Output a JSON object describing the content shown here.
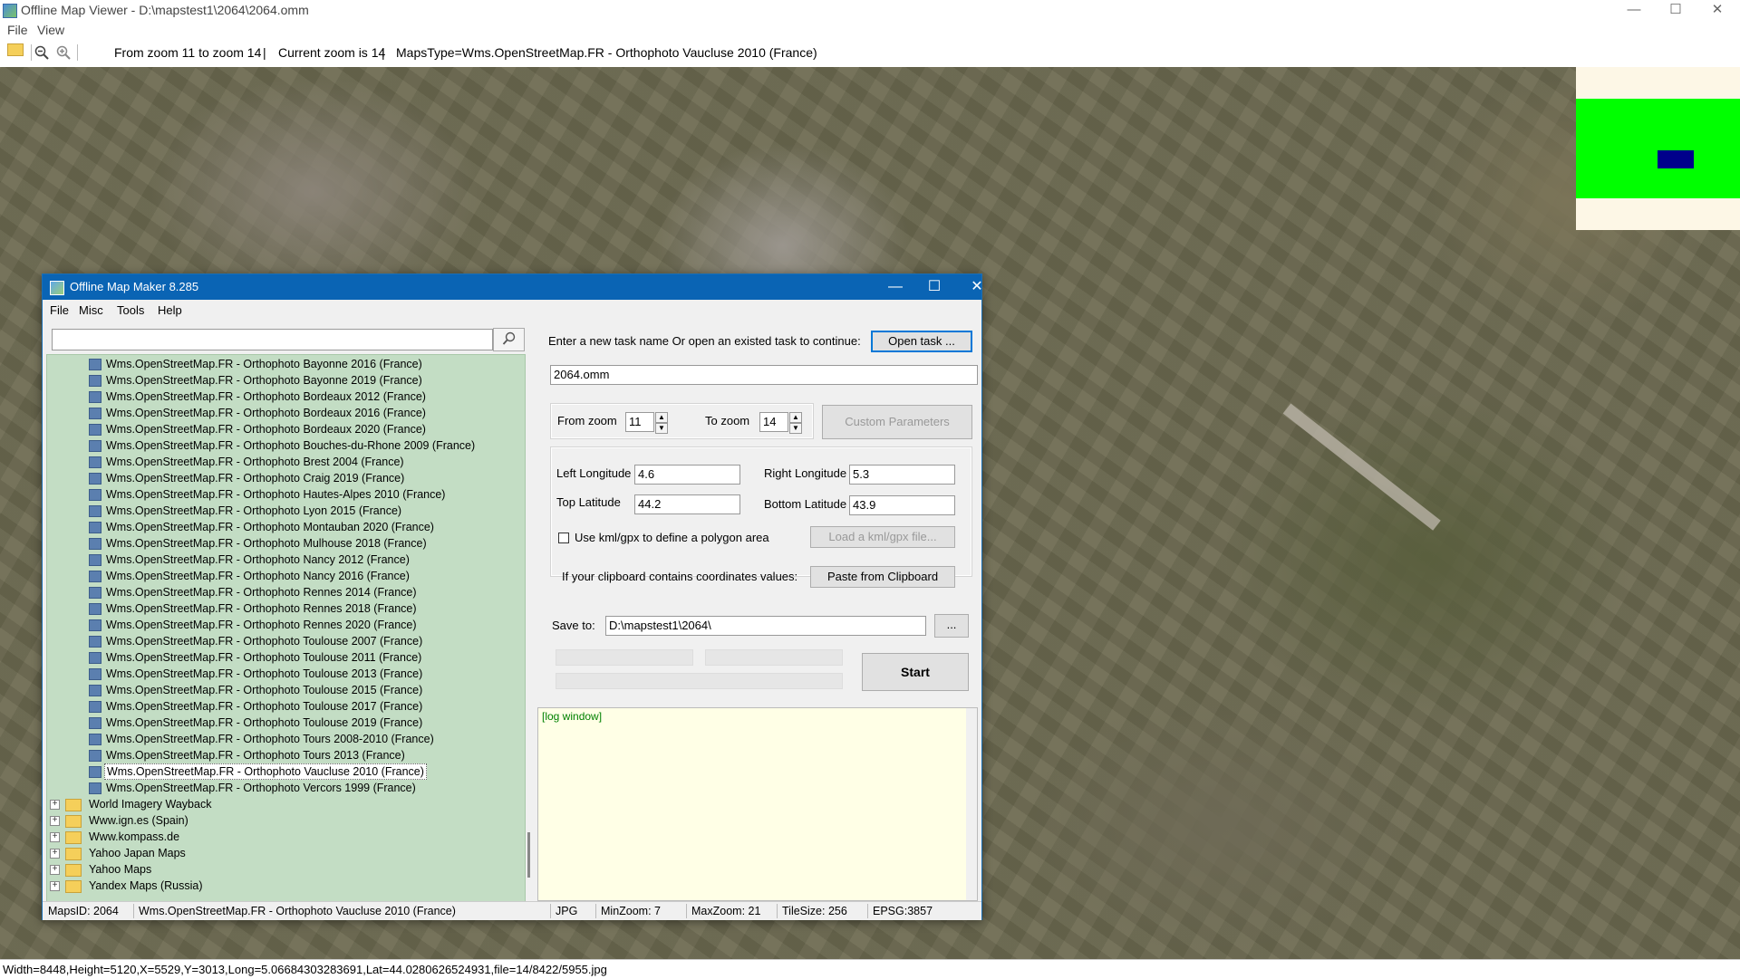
{
  "outer_window": {
    "title": "Offline Map Viewer - D:\\mapstest1\\2064\\2064.omm",
    "menu": [
      "File",
      "View"
    ],
    "toolbar": {
      "zoom_range_text": "From zoom 11 to zoom 14",
      "separator1": "|",
      "current_zoom_text": "Current zoom is 14",
      "separator2": "|",
      "maps_type_text": "MapsType=Wms.OpenStreetMap.FR - Orthophoto Vaucluse 2010 (France)"
    },
    "status_text": "Width=8448,Height=5120,X=5529,Y=3013,Long=5.06684303283691,Lat=44.0280626524931,file=14/8422/5955.jpg"
  },
  "icons": {
    "app": "map-app-icon",
    "open": "folder-open-icon",
    "zoom_out": "zoom-out-icon",
    "zoom_in": "zoom-in-icon",
    "search": "search-icon",
    "minimize": "minimize-icon",
    "maximize": "maximize-icon",
    "close": "close-icon"
  },
  "window_controls": {
    "minimize": "—",
    "maximize": "☐",
    "close": "✕"
  },
  "colors": {
    "dialog_title": "#0a64b4",
    "tree_bg": "#c3ddc4",
    "minimap_green": "#00ff00",
    "minimap_view": "#00008b",
    "log_text": "#008000"
  },
  "dialog": {
    "title": "Offline Map Maker 8.285",
    "menu": [
      "File",
      "Misc",
      "Tools",
      "Help"
    ],
    "search": {
      "value": "",
      "button": "⌕"
    },
    "tree_items": [
      "Wms.OpenStreetMap.FR - Orthophoto Bayonne 2016 (France)",
      "Wms.OpenStreetMap.FR - Orthophoto Bayonne 2019 (France)",
      "Wms.OpenStreetMap.FR - Orthophoto Bordeaux 2012 (France)",
      "Wms.OpenStreetMap.FR - Orthophoto Bordeaux 2016 (France)",
      "Wms.OpenStreetMap.FR - Orthophoto Bordeaux 2020 (France)",
      "Wms.OpenStreetMap.FR - Orthophoto Bouches-du-Rhone 2009 (France)",
      "Wms.OpenStreetMap.FR - Orthophoto Brest 2004 (France)",
      "Wms.OpenStreetMap.FR - Orthophoto Craig 2019 (France)",
      "Wms.OpenStreetMap.FR - Orthophoto Hautes-Alpes 2010 (France)",
      "Wms.OpenStreetMap.FR - Orthophoto Lyon 2015 (France)",
      "Wms.OpenStreetMap.FR - Orthophoto Montauban 2020 (France)",
      "Wms.OpenStreetMap.FR - Orthophoto Mulhouse 2018 (France)",
      "Wms.OpenStreetMap.FR - Orthophoto Nancy 2012 (France)",
      "Wms.OpenStreetMap.FR - Orthophoto Nancy 2016 (France)",
      "Wms.OpenStreetMap.FR - Orthophoto Rennes 2014 (France)",
      "Wms.OpenStreetMap.FR - Orthophoto Rennes 2018 (France)",
      "Wms.OpenStreetMap.FR - Orthophoto Rennes 2020 (France)",
      "Wms.OpenStreetMap.FR - Orthophoto Toulouse 2007 (France)",
      "Wms.OpenStreetMap.FR - Orthophoto Toulouse 2011 (France)",
      "Wms.OpenStreetMap.FR - Orthophoto Toulouse 2013 (France)",
      "Wms.OpenStreetMap.FR - Orthophoto Toulouse 2015 (France)",
      "Wms.OpenStreetMap.FR - Orthophoto Toulouse 2017 (France)",
      "Wms.OpenStreetMap.FR - Orthophoto Toulouse 2019 (France)",
      "Wms.OpenStreetMap.FR - Orthophoto Tours 2008-2010 (France)",
      "Wms.OpenStreetMap.FR - Orthophoto Tours 2013 (France)",
      "Wms.OpenStreetMap.FR - Orthophoto Vaucluse 2010 (France)",
      "Wms.OpenStreetMap.FR - Orthophoto Vercors 1999 (France)"
    ],
    "selected_item": "Wms.OpenStreetMap.FR - Orthophoto Vaucluse 2010 (France)",
    "tree_folders": [
      "World Imagery Wayback",
      "Www.ign.es (Spain)",
      "Www.kompass.de",
      "Yahoo Japan Maps",
      "Yahoo Maps",
      "Yandex Maps (Russia)"
    ],
    "form": {
      "task_prompt": "Enter a new task name Or open an existed task to continue:",
      "open_task_button": "Open task ...",
      "task_name_value": "2064.omm",
      "from_zoom_label": "From zoom",
      "from_zoom_value": "11",
      "to_zoom_label": "To zoom",
      "to_zoom_value": "14",
      "custom_params_button": "Custom Parameters",
      "left_longitude_label": "Left Longitude",
      "left_longitude_value": "4.6",
      "right_longitude_label": "Right Longitude",
      "right_longitude_value": "5.3",
      "top_latitude_label": "Top Latitude",
      "top_latitude_value": "44.2",
      "bottom_latitude_label": "Bottom Latitude",
      "bottom_latitude_value": "43.9",
      "kml_checkbox_label": "Use kml/gpx to define a polygon area",
      "kml_checkbox_checked": false,
      "load_kml_button": "Load a kml/gpx file...",
      "clipboard_prompt": "If your clipboard contains coordinates values:",
      "paste_button": "Paste from Clipboard",
      "save_to_label": "Save to:",
      "save_to_value": "D:\\mapstest1\\2064\\",
      "browse_button": "...",
      "start_button": "Start"
    },
    "log_text": "[log window]",
    "status": {
      "maps_id": "MapsID: 2064",
      "map_name": "Wms.OpenStreetMap.FR - Orthophoto Vaucluse 2010 (France)",
      "format": "JPG",
      "min_zoom": "MinZoom: 7",
      "max_zoom": "MaxZoom: 21",
      "tile_size": "TileSize: 256",
      "epsg": "EPSG:3857"
    }
  }
}
